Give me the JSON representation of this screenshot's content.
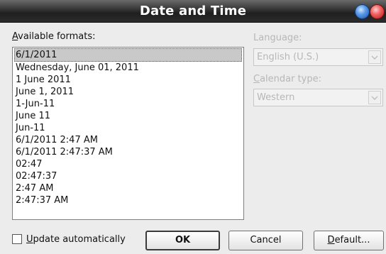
{
  "window": {
    "title": "Date and Time"
  },
  "formats": {
    "label_accel": "A",
    "label_rest": "vailable formats:",
    "items": [
      "6/1/2011",
      "Wednesday, June 01, 2011",
      "1 June 2011",
      "June 1, 2011",
      "1-Jun-11",
      "June 11",
      "Jun-11",
      "6/1/2011 2:47 AM",
      "6/1/2011 2:47:37 AM",
      "02:47",
      "02:47:37",
      "2:47 AM",
      "2:47:37 AM"
    ],
    "selected_index": 0
  },
  "language": {
    "label": "Language:",
    "value": "English (U.S.)"
  },
  "calendar": {
    "label_accel": "C",
    "label_rest": "alendar type:",
    "value": "Western"
  },
  "update_auto": {
    "label_accel": "U",
    "label_rest": "pdate automatically",
    "checked": false
  },
  "buttons": {
    "ok": "OK",
    "cancel": "Cancel",
    "default_accel": "D",
    "default_rest": "efault..."
  }
}
